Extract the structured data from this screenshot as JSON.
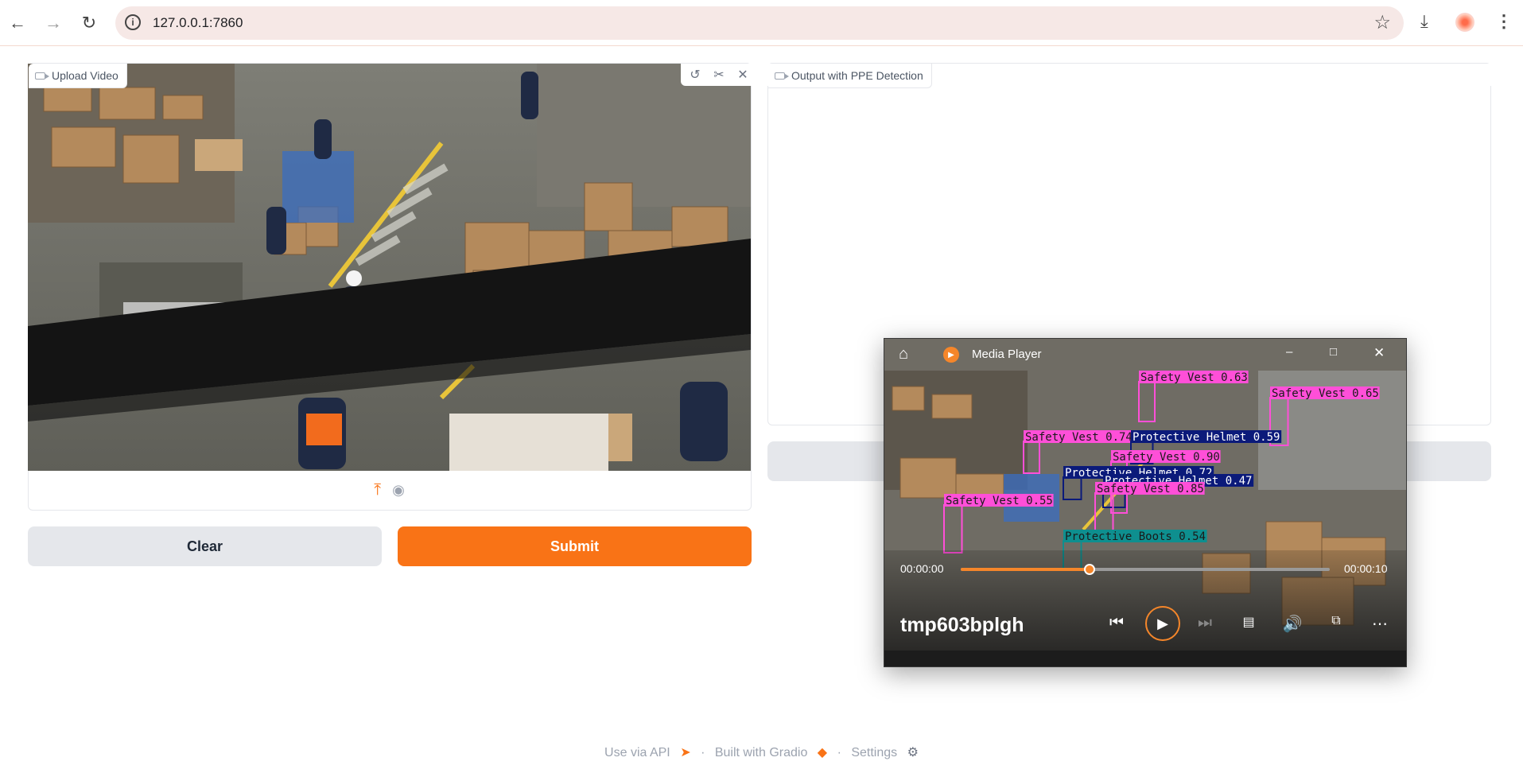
{
  "browser": {
    "url": "127.0.0.1:7860"
  },
  "input_panel": {
    "label": "Upload Video"
  },
  "buttons": {
    "clear": "Clear",
    "submit": "Submit"
  },
  "output_panel": {
    "label": "Output with PPE Detection"
  },
  "media_player": {
    "app_title": "Media Player",
    "file_name": "tmp603bplgh",
    "current_time": "00:00:00",
    "total_time": "00:00:10",
    "progress": 0.35,
    "detections": [
      "Safety Vest 0.63",
      "Safety Vest 0.65",
      "Safety Vest 0.74",
      "Protective Helmet 0.59",
      "Safety Vest 0.90",
      "Protective Helmet 0.72",
      "Protective Helmet 0.47",
      "Safety Vest 0.85",
      "Safety Vest 0.55",
      "Protective Boots 0.54"
    ]
  },
  "footer": {
    "api": "Use via API",
    "built": "Built with Gradio",
    "settings": "Settings"
  },
  "colors": {
    "accent": "#f97316",
    "vest_box": "#ff4fd8",
    "helmet_box": "#0b1a7a",
    "boots_box": "#0e8f8f"
  }
}
